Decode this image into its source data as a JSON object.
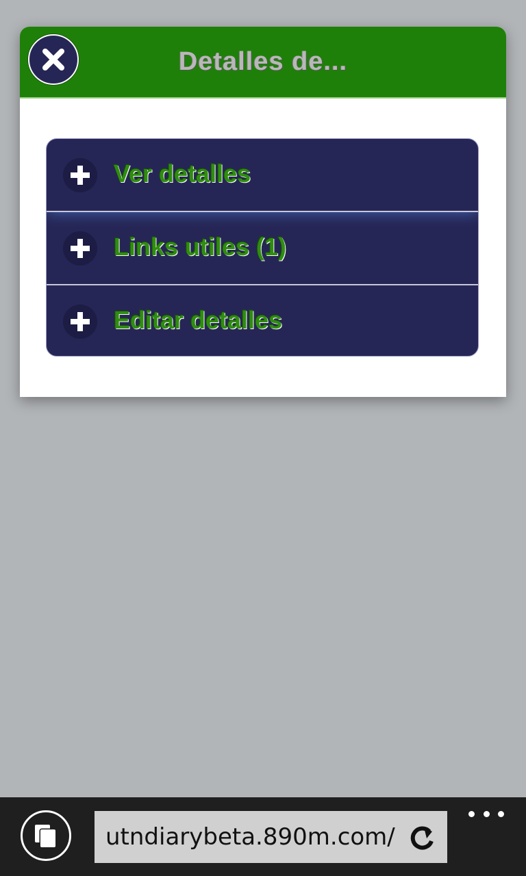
{
  "dialog": {
    "title": "Detalles de...",
    "close_icon": "close-icon",
    "header_color": "#1f8009",
    "menu_items": [
      {
        "label": "Ver detalles",
        "icon": "plus-icon"
      },
      {
        "label": "Links utiles (1)",
        "icon": "plus-icon"
      },
      {
        "label": "Editar detalles",
        "icon": "plus-icon"
      }
    ]
  },
  "browser": {
    "url": "utndiarybeta.890m.com/",
    "tabs_icon": "tabs-icon",
    "refresh_icon": "refresh-icon",
    "more_icon": "more-options-icon"
  }
}
